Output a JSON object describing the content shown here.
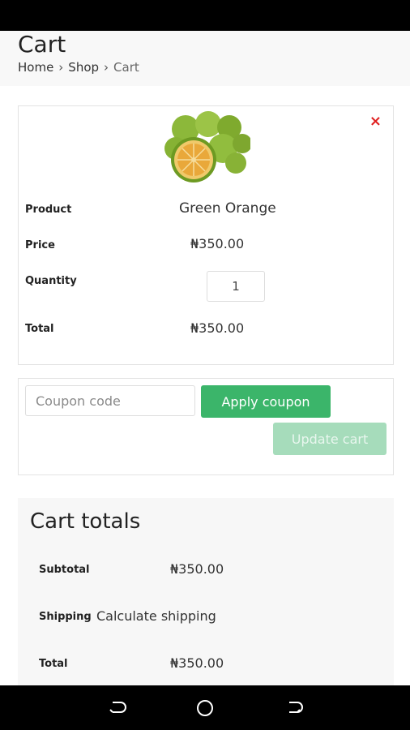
{
  "header": {
    "title": "Cart",
    "breadcrumb": [
      "Home",
      "Shop",
      "Cart"
    ]
  },
  "cart_item": {
    "product_label": "Product",
    "product_name": "Green Orange",
    "price_label": "Price",
    "price": "₦350.00",
    "quantity_label": "Quantity",
    "quantity": "1",
    "total_label": "Total",
    "total": "₦350.00",
    "remove_glyph": "×"
  },
  "coupon": {
    "placeholder": "Coupon code",
    "apply_label": "Apply coupon",
    "update_label": "Update cart"
  },
  "totals": {
    "title": "Cart totals",
    "subtotal_label": "Subtotal",
    "subtotal": "₦350.00",
    "shipping_label": "Shipping",
    "shipping_value": "Calculate shipping",
    "total_label": "Total",
    "total": "₦350.00"
  },
  "colors": {
    "accent": "#3bb56a",
    "accent_disabled": "#a6dcbb",
    "remove": "#e02020"
  },
  "icons": [
    "close-icon",
    "back-nav-icon",
    "home-nav-icon",
    "recents-nav-icon"
  ]
}
